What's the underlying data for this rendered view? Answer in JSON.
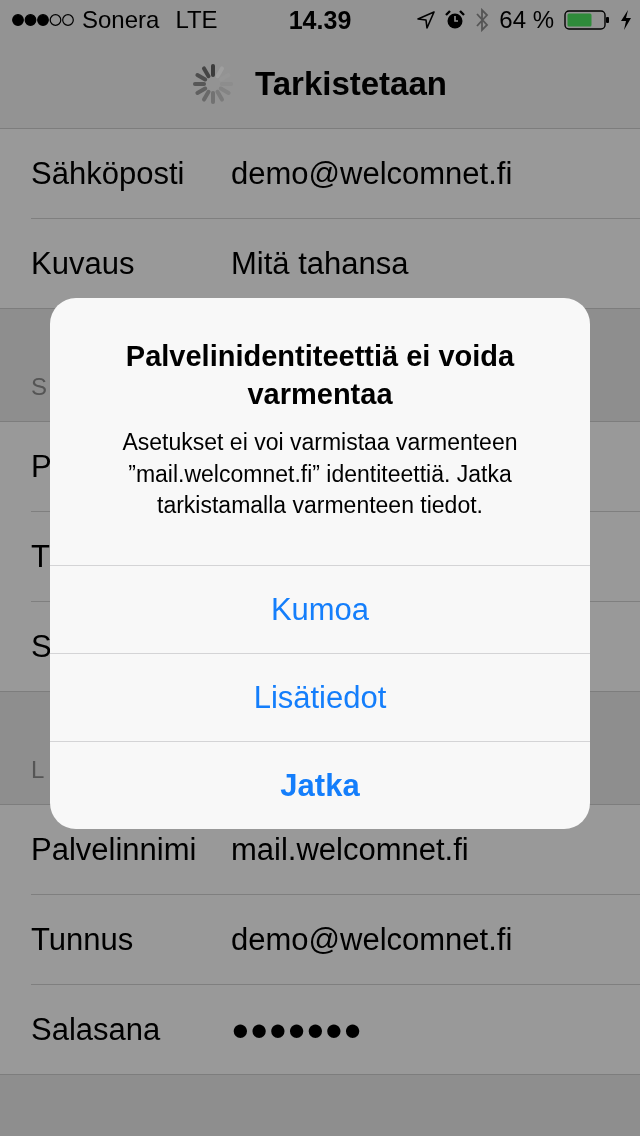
{
  "status_bar": {
    "carrier": "Sonera",
    "network": "LTE",
    "time": "14.39",
    "battery": "64 %"
  },
  "nav_bar": {
    "title": "Tarkistetaan"
  },
  "sections": [
    {
      "rows": [
        {
          "label": "Sähköposti",
          "value": "demo@welcomnet.fi"
        },
        {
          "label": "Kuvaus",
          "value": "Mitä tahansa"
        }
      ]
    },
    {
      "header": "S",
      "rows": [
        {
          "label": "P"
        },
        {
          "label": "T"
        },
        {
          "label": "S"
        }
      ]
    },
    {
      "header": "L",
      "rows": [
        {
          "label": "Palvelinnimi",
          "value": "mail.welcomnet.fi"
        },
        {
          "label": "Tunnus",
          "value": "demo@welcomnet.fi"
        },
        {
          "label": "Salasana",
          "value": "●●●●●●●"
        }
      ]
    }
  ],
  "alert": {
    "title": "Palvelinidentiteettiä ei voida varmentaa",
    "message": "Asetukset ei voi varmistaa varmenteen ”mail.welcomnet.fi” identiteettiä. Jatka tarkistamalla varmenteen tiedot.",
    "buttons": [
      {
        "label": "Kumoa",
        "kind": "cancel"
      },
      {
        "label": "Lisätiedot",
        "kind": "default"
      },
      {
        "label": "Jatka",
        "kind": "preferred"
      }
    ]
  }
}
